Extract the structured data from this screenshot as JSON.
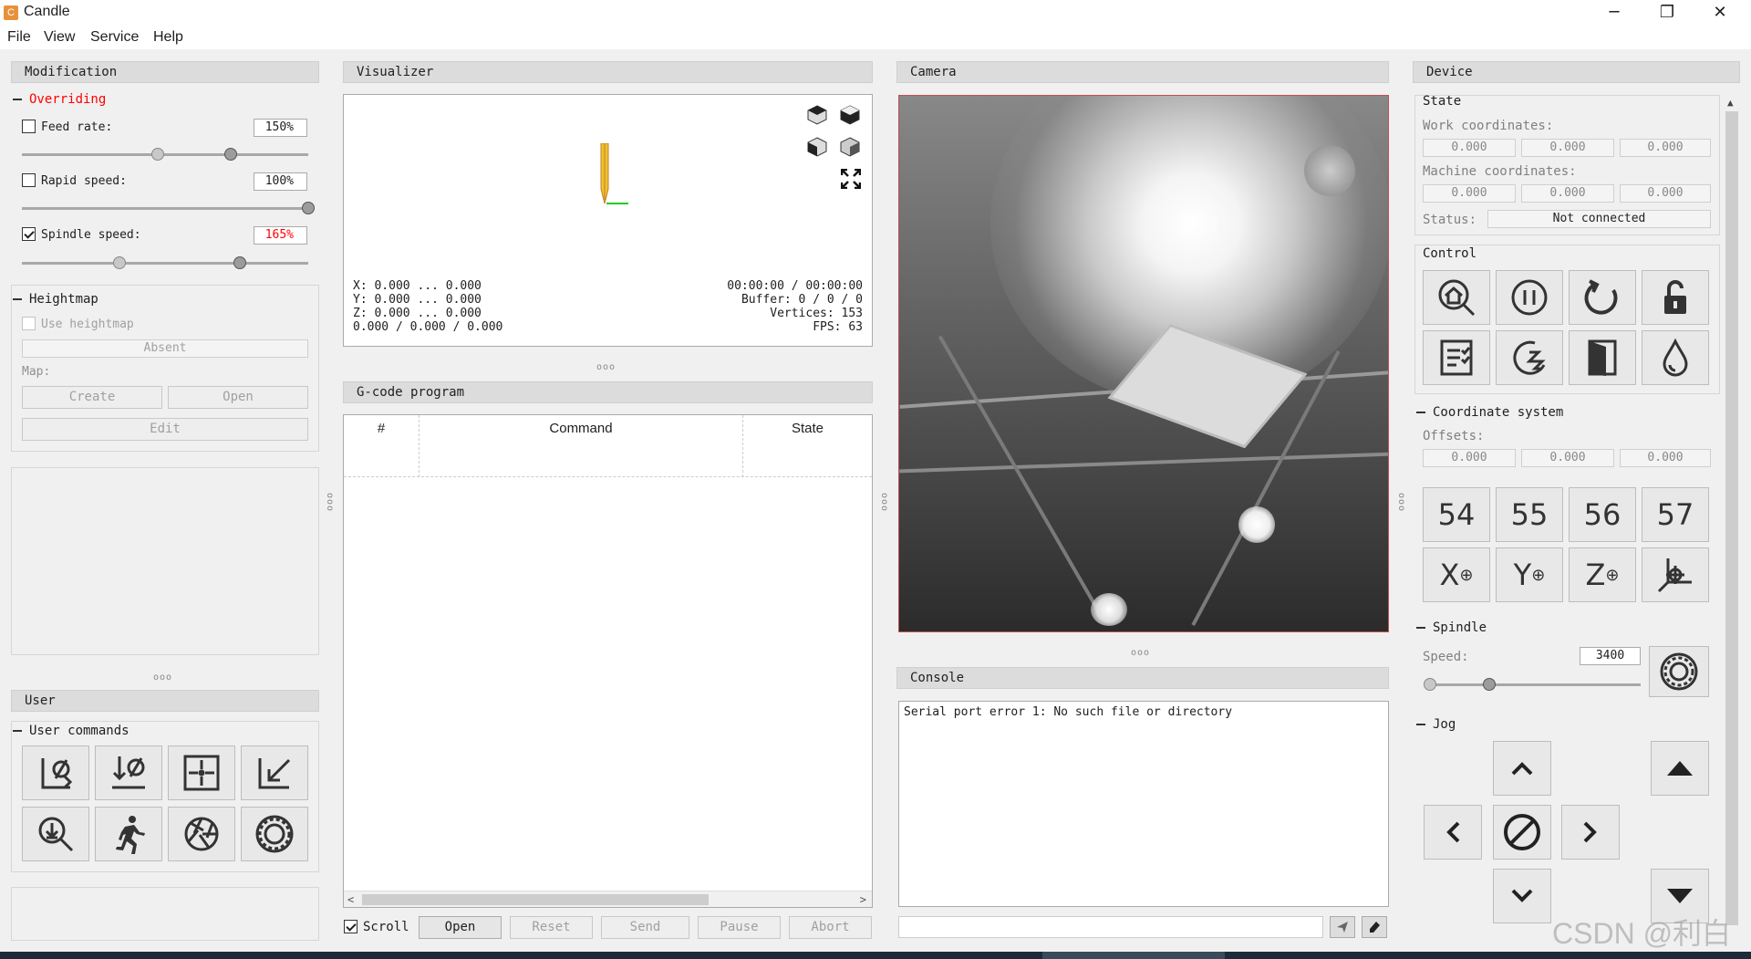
{
  "window": {
    "title": "Candle",
    "minimize": "─",
    "maximize": "❐",
    "close": "✕"
  },
  "menu": [
    "File",
    "View",
    "Service",
    "Help"
  ],
  "modification": {
    "header": "Modification",
    "overriding": {
      "title": "Overriding",
      "title_color": "#ff0000",
      "feed_rate": {
        "label": "Feed rate:",
        "value": "150%",
        "checked": false,
        "level": 0.73
      },
      "rapid_speed": {
        "label": "Rapid speed:",
        "value": "100%",
        "checked": false,
        "level": 1.0
      },
      "spindle_speed": {
        "label": "Spindle speed:",
        "value": "165%",
        "value_color": "#ff0000",
        "checked": true,
        "level": 0.76
      }
    },
    "heightmap": {
      "title": "Heightmap",
      "use_label": "Use heightmap",
      "absent": "Absent",
      "map_label": "Map:",
      "create": "Create",
      "open": "Open",
      "edit": "Edit"
    }
  },
  "user": {
    "header": "User",
    "commands_title": "User commands",
    "icons": [
      "zero-z-icon",
      "probe-zero-icon",
      "center-frame-icon",
      "corner-return-icon",
      "probe-magnify-icon",
      "run-icon",
      "aperture-icon",
      "spindle-icon"
    ]
  },
  "visualizer": {
    "header": "Visualizer",
    "coords": [
      "X: 0.000 ... 0.000",
      "Y: 0.000 ... 0.000",
      "Z: 0.000 ... 0.000",
      "0.000 / 0.000 / 0.000"
    ],
    "stats": [
      "00:00:00 / 00:00:00",
      "Buffer: 0 / 0 / 0",
      "Vertices: 153",
      "FPS: 63"
    ]
  },
  "gcode": {
    "header": "G-code program",
    "columns": [
      "#",
      "Command",
      "State"
    ],
    "scroll_label": "Scroll",
    "scroll_checked": true,
    "buttons": {
      "open": "Open",
      "reset": "Reset",
      "send": "Send",
      "pause": "Pause",
      "abort": "Abort"
    }
  },
  "camera": {
    "header": "Camera"
  },
  "console": {
    "header": "Console",
    "text": "Serial port error 1: No such file or directory",
    "input": ""
  },
  "device": {
    "header": "Device",
    "state": {
      "title": "State",
      "work_label": "Work coordinates:",
      "work": [
        "0.000",
        "0.000",
        "0.000"
      ],
      "machine_label": "Machine coordinates:",
      "machine": [
        "0.000",
        "0.000",
        "0.000"
      ],
      "status_label": "Status:",
      "status": "Not connected"
    },
    "control": {
      "title": "Control",
      "icons": [
        "home-icon",
        "pause-icon",
        "reset-icon",
        "unlock-icon",
        "checklist-icon",
        "sleep-icon",
        "door-icon",
        "flood-icon"
      ]
    },
    "coordinate_system": {
      "title": "Coordinate system",
      "offsets_label": "Offsets:",
      "offsets": [
        "0.000",
        "0.000",
        "0.000"
      ],
      "g_buttons": [
        "54",
        "55",
        "56",
        "57"
      ],
      "zero_buttons": [
        "X",
        "Y",
        "Z"
      ]
    },
    "spindle": {
      "title": "Spindle",
      "speed_label": "Speed:",
      "speed": "3400",
      "level": 0.3
    },
    "jog": {
      "title": "Jog"
    }
  },
  "watermark": "CSDN @利白"
}
